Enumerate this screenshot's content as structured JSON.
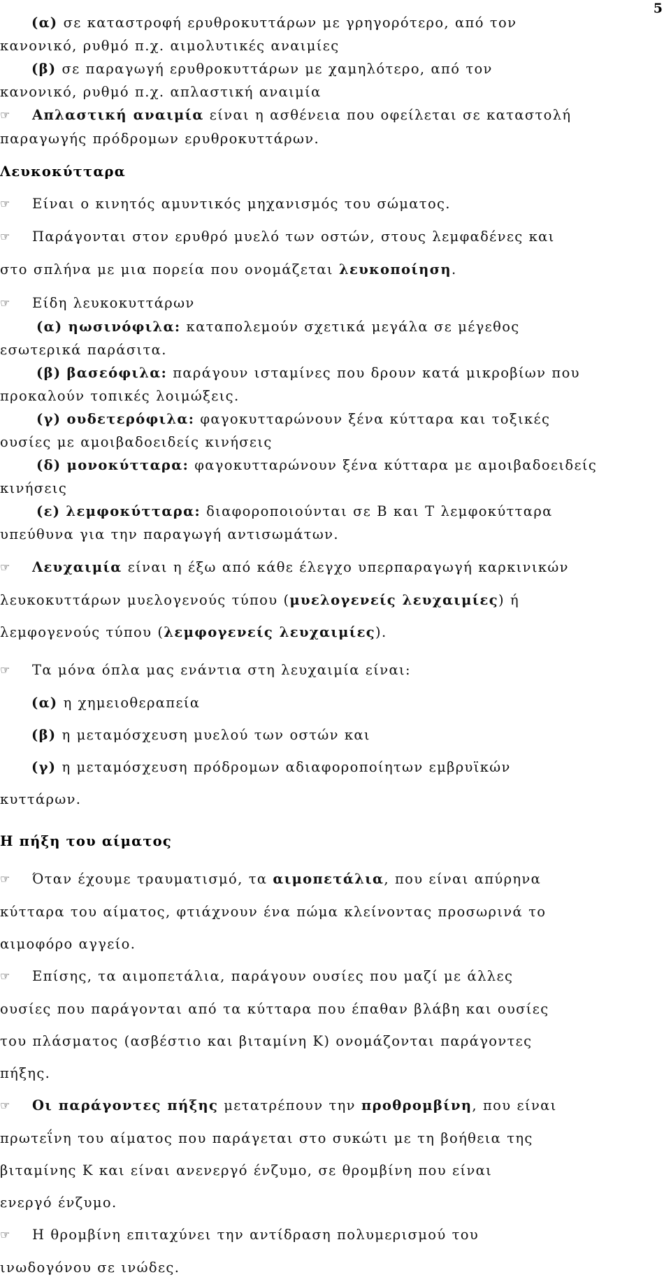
{
  "page": {
    "number": "5",
    "bullet_glyph": "☞",
    "language": "el"
  },
  "anemia_causes": {
    "items": [
      {
        "marker": "(α)",
        "line1": "σε καταστροφή ερυθροκυττάρων με γρηγορότερο, από τον",
        "line2": "κανονικό, ρυθμό π.χ. αιμολυτικές αναιμίες"
      },
      {
        "marker": "(β)",
        "line1": "σε παραγωγή ερυθροκυττάρων με χαμηλότερο, από τον",
        "line2": "κανονικό, ρυθμό π.χ. απλαστική αναιμία"
      }
    ]
  },
  "aplastic_anemia": {
    "bold_term": "Απλαστική αναιμία",
    "rest_line1": " είναι η ασθένεια που οφείλεται σε καταστολή",
    "line2": "παραγωγής πρόδρομων ερυθροκυττάρων."
  },
  "leukocytes": {
    "heading": "Λευκοκύτταρα",
    "bullet_1": "Είναι ο κινητός αμυντικός μηχανισμός του σώματος.",
    "bullet_2_line1": "Παράγονται στον ερυθρό μυελό των οστών, στους λεμφαδένες και",
    "bullet_2_line2_pre": "στο σπλήνα με μια πορεία που ονομάζεται ",
    "bullet_2_line2_bold": "λευκοποίηση",
    "bullet_2_line2_post": ".",
    "types_intro": "Είδη λευκοκυττάρων",
    "types": [
      {
        "marker": "(α)",
        "name": "ηωσινόφιλα:",
        "desc_line1": "καταπολεμούν σχετικά μεγάλα σε μέγεθος",
        "desc_line2": "εσωτερικά παράσιτα."
      },
      {
        "marker": "(β)",
        "name": "βασεόφιλα:",
        "desc_line1": "παράγουν ισταμίνες που δρουν κατά μικροβίων που",
        "desc_line2": "προκαλούν τοπικές λοιμώξεις."
      },
      {
        "marker": "(γ)",
        "name": "ουδετερόφιλα:",
        "desc_line1": "φαγοκυτταρώνουν ξένα κύτταρα και τοξικές",
        "desc_line2": "ουσίες με αμοιβαδοειδείς κινήσεις"
      },
      {
        "marker": "(δ)",
        "name": "μονοκύτταρα:",
        "desc_line1": "φαγοκυτταρώνουν ξένα κύτταρα με αμοιβαδοειδείς",
        "desc_line2": "κινήσεις"
      },
      {
        "marker": "(ε)",
        "name": "λεμφοκύτταρα:",
        "desc_line1": "διαφοροποιούνται σε Β και Τ λεμφοκύτταρα",
        "desc_line2": "υπεύθυνα για την παραγωγή αντισωμάτων."
      }
    ]
  },
  "leukemia": {
    "bold_term": "Λευχαιμία",
    "line1_rest": " είναι η έξω από κάθε έλεγχο υπερπαραγωγή καρκινικών",
    "line2_pre": "λευκοκυττάρων μυελογενούς τύπου (",
    "line2_bold": "μυελογενείς λευχαιμίες",
    "line2_post": ") ή",
    "line3_pre": "λεμφογενούς τύπου (",
    "line3_bold": "λεμφογενείς λευχαιμίες",
    "line3_post": ").",
    "treatments_intro": "Τα μόνα όπλα μας ενάντια στη λευχαιμία είναι:",
    "treatments": [
      {
        "marker": "(α)",
        "text": "η χημειοθεραπεία"
      },
      {
        "marker": "(β)",
        "text": "η μεταμόσχευση μυελού των οστών και"
      },
      {
        "marker": "(γ)",
        "text": "η μεταμόσχευση πρόδρομων αδιαφοροποίητων εμβρυϊκών",
        "text_line2": "κυττάρων."
      }
    ]
  },
  "coagulation": {
    "heading": "Η πήξη του αίματος",
    "p1_pre": "Όταν έχουμε τραυματισμό, τα ",
    "p1_bold": "αιμοπετάλια",
    "p1_post": ", που είναι απύρηνα",
    "p1_line2": "κύτταρα του αίματος, φτιάχνουν ένα πώμα κλείνοντας προσωρινά το",
    "p1_line3": "αιμοφόρο αγγείο.",
    "p2_line1": "Επίσης, τα αιμοπετάλια, παράγουν ουσίες που μαζί με άλλες",
    "p2_line2": "ουσίες που παράγονται από τα κύτταρα που έπαθαν βλάβη και ουσίες",
    "p2_line3": "του πλάσματος (ασβέστιο και βιταμίνη Κ) ονομάζονται παράγοντες",
    "p2_line4": "πήξης.",
    "p3_pre": "Οι ",
    "p3_bold1": "παράγοντες πήξης",
    "p3_mid": " μετατρέπουν την ",
    "p3_bold2": "προθρομβίνη",
    "p3_post": ", που είναι",
    "p3_line2": "πρωτεΐνη του αίματος που παράγεται στο συκώτι με τη βοήθεια της",
    "p3_line3": "βιταμίνης Κ και είναι ανενεργό ένζυμο, σε θρομβίνη που είναι",
    "p3_line4": "ενεργό ένζυμο.",
    "p4_line1": "Η θρομβίνη επιταχύνει την αντίδραση πολυμερισμού του",
    "p4_line2": "ινωδογόνου σε ινώδες."
  }
}
